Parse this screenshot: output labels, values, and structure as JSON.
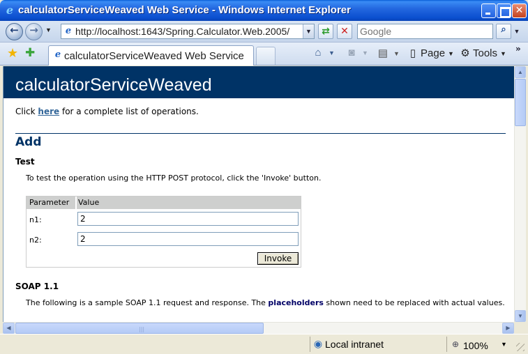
{
  "window": {
    "title": "calculatorServiceWeaved Web Service - Windows Internet Explorer",
    "app_icon": "ie-logo-icon"
  },
  "address_bar": {
    "url": "http://localhost:1643/Spring.Calculator.Web.2005/",
    "search_placeholder": "Google"
  },
  "tab": {
    "label": "calculatorServiceWeaved Web Service"
  },
  "command_bar": {
    "page_label": "Page",
    "tools_label": "Tools"
  },
  "page": {
    "service_title": "calculatorServiceWeaved",
    "intro_prefix": "Click ",
    "intro_link": "here",
    "intro_suffix": " for a complete list of operations.",
    "operation_title": "Add",
    "test_heading": "Test",
    "test_description": "To test the operation using the HTTP POST protocol, click the 'Invoke' button.",
    "param_table": {
      "headers": [
        "Parameter",
        "Value"
      ],
      "rows": [
        {
          "name": "n1:",
          "value": "2"
        },
        {
          "name": "n2:",
          "value": "2"
        }
      ],
      "invoke_label": "Invoke"
    },
    "soap_heading": "SOAP 1.1",
    "soap_desc_prefix": "The following is a sample SOAP 1.1 request and response. The ",
    "soap_desc_emphasis": "placeholders",
    "soap_desc_suffix": " shown need to be replaced with actual values."
  },
  "status_bar": {
    "zone": "Local intranet",
    "zoom": "100%"
  },
  "colors": {
    "heading_band": "#003366",
    "link": "#336699",
    "title_bar": "#0a4fcf"
  }
}
